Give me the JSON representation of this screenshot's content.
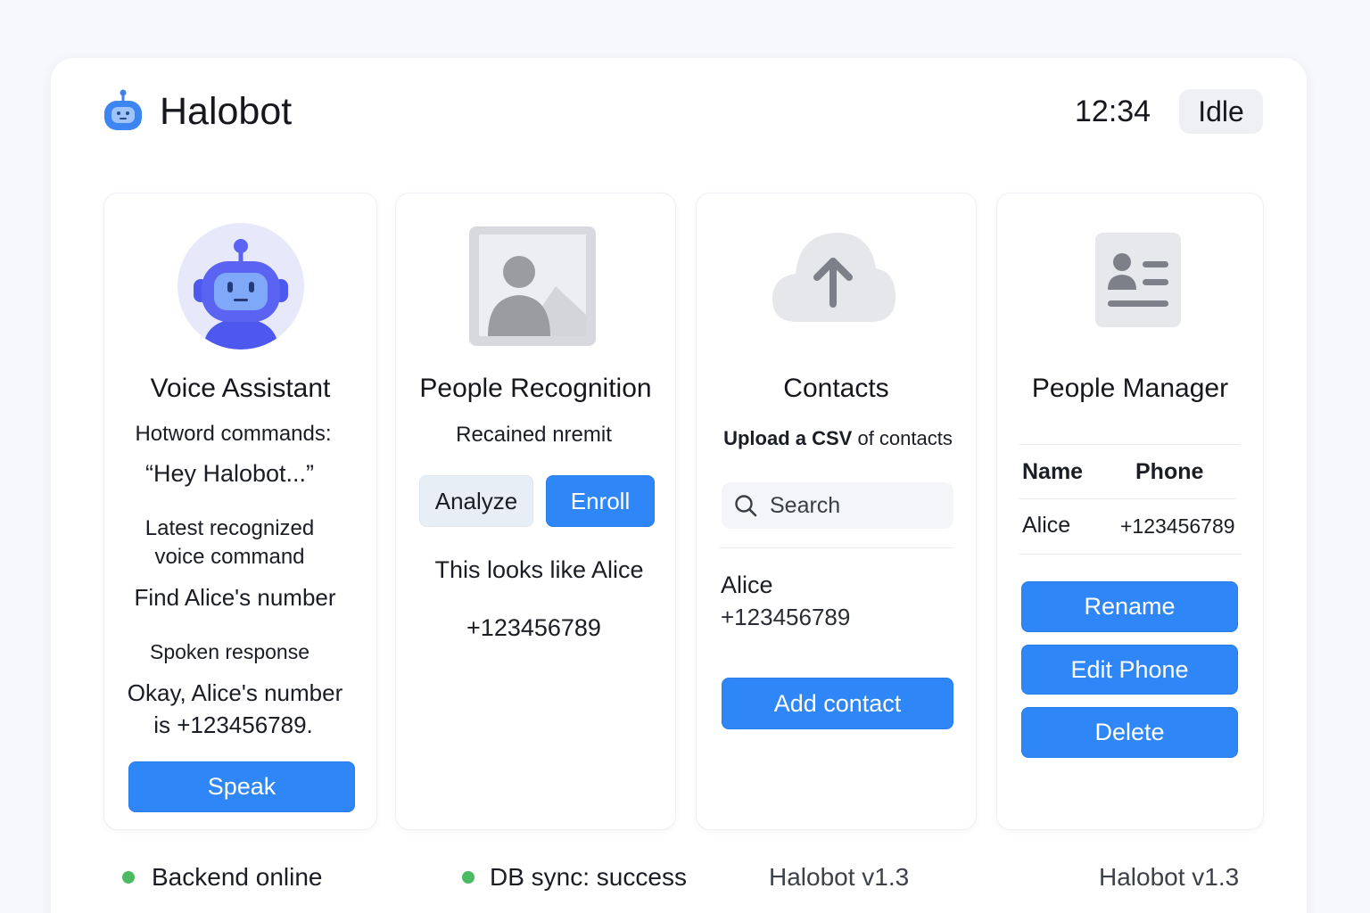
{
  "app": {
    "title": "Halobot",
    "logo_icon": "robot-icon"
  },
  "header": {
    "time": "12:34",
    "status": "Idle"
  },
  "colors": {
    "primary": "#2f86f6",
    "online": "#4cb963",
    "avatar_bg": "#e7e9fb",
    "robot": "#5a63f2"
  },
  "voice": {
    "title": "Voice Assistant",
    "hotword_label": "Hotword commands:",
    "hotword": "“Hey Halobot...”",
    "latest_label_1": "Latest recognized",
    "latest_label_2": "voice command",
    "latest_command": "Find Alice's number",
    "response_label": "Spoken response",
    "response_1": "Okay, Alice's number",
    "response_2": "is +123456789.",
    "speak_label": "Speak",
    "avatar_icon": "robot-icon"
  },
  "recognition": {
    "title": "People Recognition",
    "subtitle": "Recained nremit",
    "analyze_label": "Analyze",
    "enroll_label": "Enroll",
    "result": "This looks like Alice",
    "phone": "+123456789",
    "image_icon": "person-image-placeholder-icon"
  },
  "contacts": {
    "title": "Contacts",
    "upload_strong": "Upload a CSV",
    "upload_rest": " of contacts",
    "search_placeholder": "Search",
    "contact_name": "Alice",
    "contact_phone": "+123456789",
    "add_label": "Add contact",
    "upload_icon": "cloud-upload-icon"
  },
  "manager": {
    "title": "People Manager",
    "col_name": "Name",
    "col_phone": "Phone",
    "rows": [
      {
        "name": "Alice",
        "phone": "+123456789"
      }
    ],
    "rename_label": "Rename",
    "edit_phone_label": "Edit Phone",
    "delete_label": "Delete",
    "card_icon": "contact-card-icon"
  },
  "footer": {
    "backend": "Backend online",
    "db": "DB sync: success",
    "version_1": "Halobot v1.3",
    "version_2": "Halobot v1.3"
  }
}
